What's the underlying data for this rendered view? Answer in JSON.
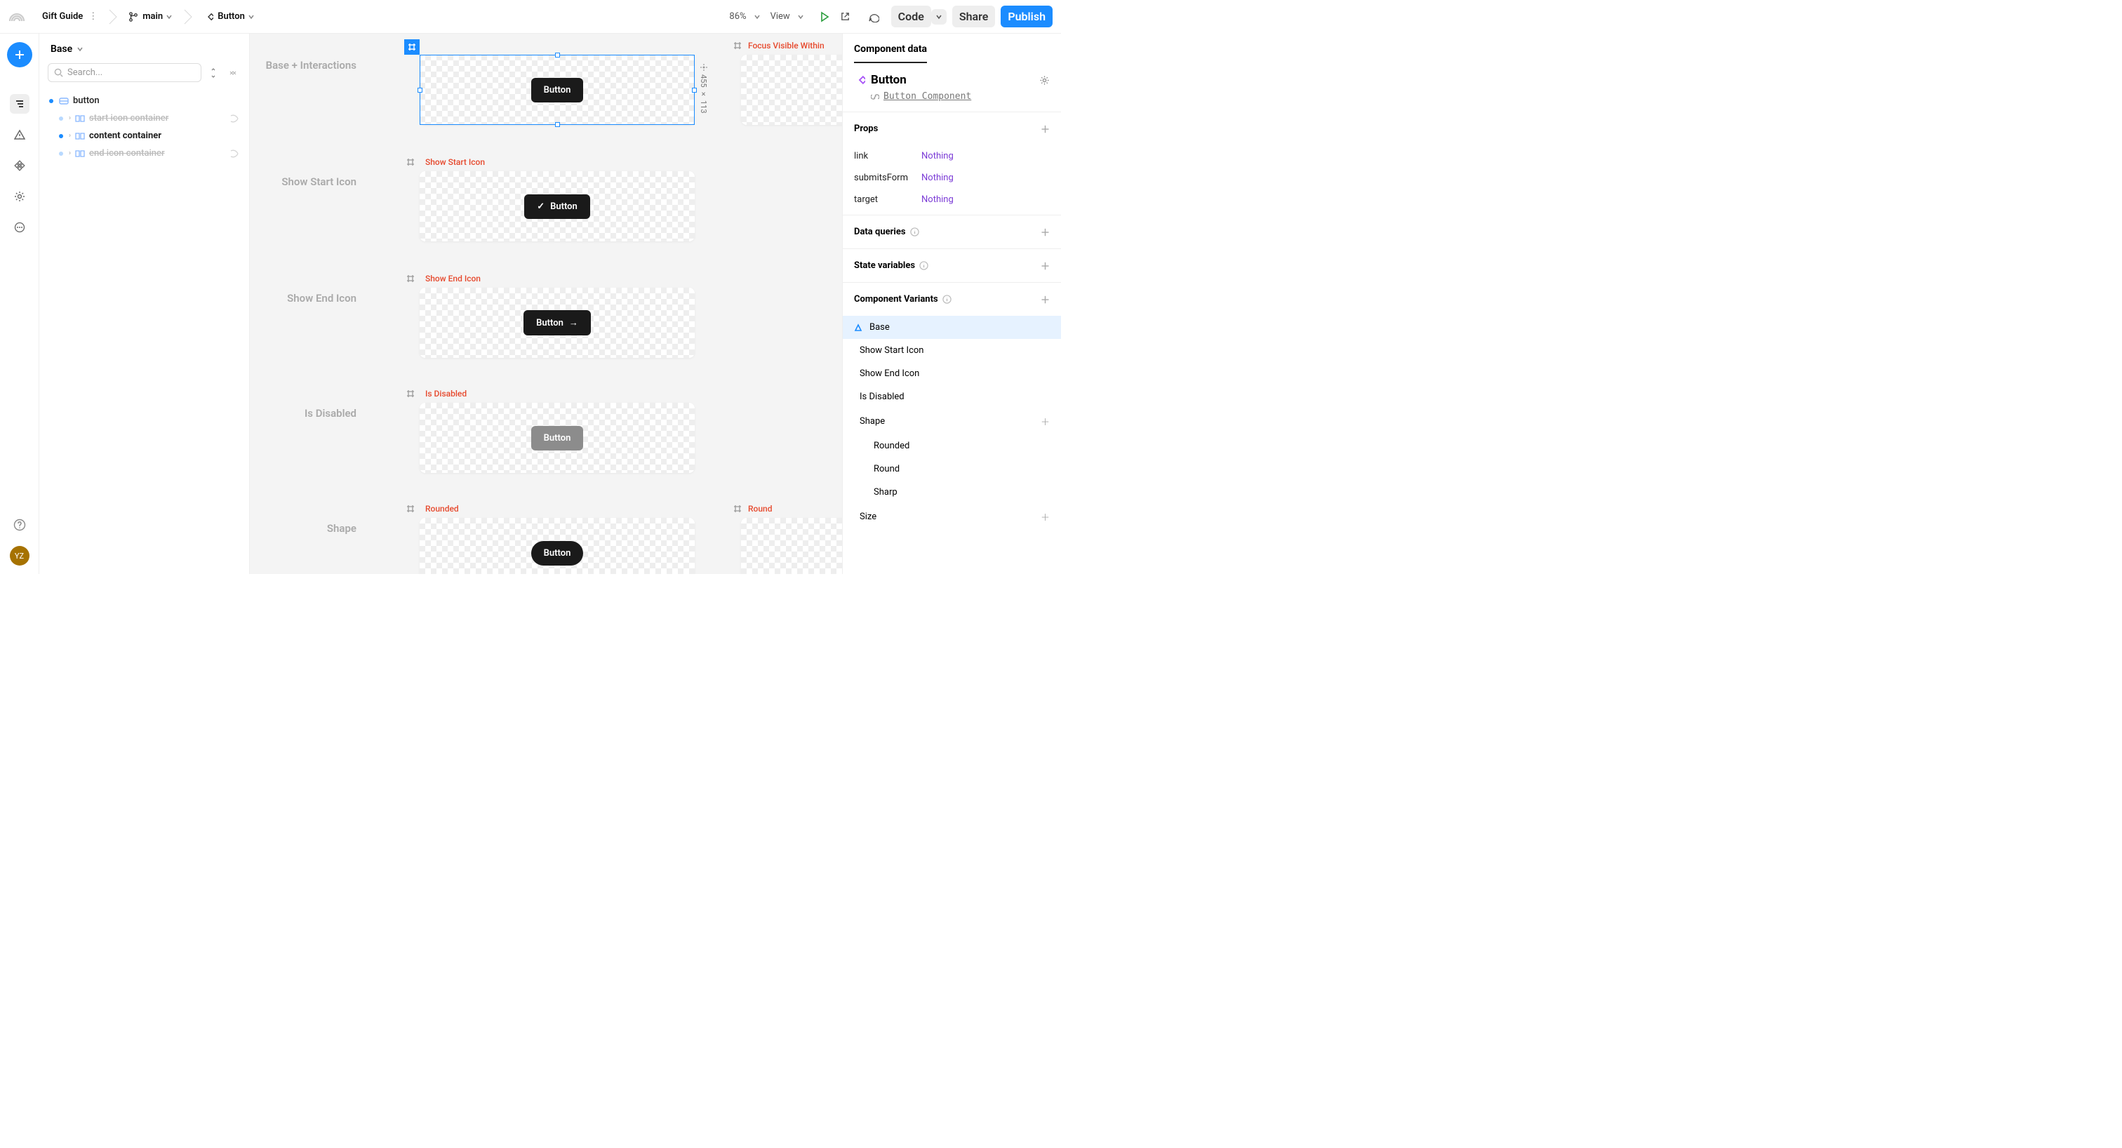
{
  "topbar": {
    "project": "Gift Guide",
    "branch": "main",
    "component": "Button",
    "zoom": "86%",
    "view": "View",
    "code": "Code",
    "share": "Share",
    "publish": "Publish"
  },
  "left_rail": {
    "avatar_initials": "YZ"
  },
  "left_panel": {
    "head": "Base",
    "search_placeholder": "Search...",
    "tree": {
      "button": "button",
      "start_icon": "start icon container",
      "content": "content container",
      "end_icon": "end icon container"
    }
  },
  "canvas": {
    "row_labels": {
      "base": "Base + Interactions",
      "start": "Show Start Icon",
      "end": "Show End Icon",
      "disabled": "Is Disabled",
      "shape": "Shape"
    },
    "variant_labels": {
      "focus": "Focus Visible Within",
      "start": "Show Start Icon",
      "end": "Show End Icon",
      "disabled": "Is Disabled",
      "rounded": "Rounded",
      "round": "Round"
    },
    "button_text": "Button",
    "dimensions": "455 × 113"
  },
  "right_panel": {
    "tab": "Component data",
    "component_name": "Button",
    "component_link": "Button Component",
    "sections": {
      "props": "Props",
      "data_queries": "Data queries",
      "state_variables": "State variables",
      "component_variants": "Component Variants",
      "size": "Size"
    },
    "props": [
      {
        "k": "link",
        "v": "Nothing"
      },
      {
        "k": "submitsForm",
        "v": "Nothing"
      },
      {
        "k": "target",
        "v": "Nothing"
      }
    ],
    "variants": {
      "base": "Base",
      "start": "Show Start Icon",
      "end": "Show End Icon",
      "disabled": "Is Disabled",
      "shape": "Shape",
      "rounded": "Rounded",
      "round": "Round",
      "sharp": "Sharp"
    }
  }
}
